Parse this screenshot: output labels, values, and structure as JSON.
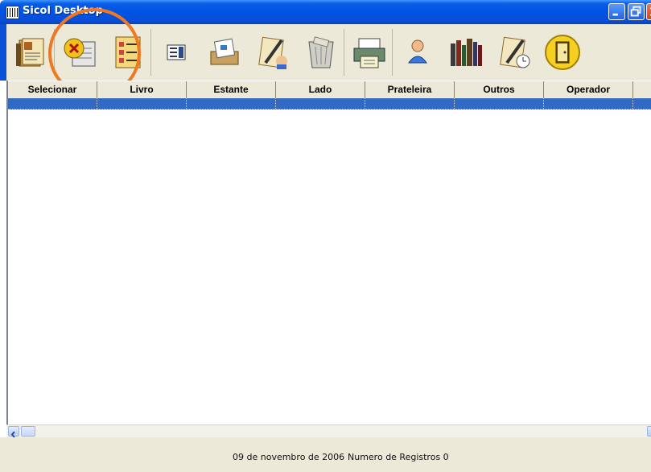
{
  "window": {
    "title": "Sicol Desktop",
    "icon": "barcode-icon",
    "controls": [
      "minimize-icon",
      "maximize-icon",
      "close-icon"
    ]
  },
  "toolbar": {
    "buttons": [
      {
        "icon": "open-book-icon"
      },
      {
        "icon": "cancel-icon"
      },
      {
        "icon": "list-document-icon"
      },
      {
        "icon": "form-selector-icon"
      },
      {
        "icon": "library-card-icon"
      },
      {
        "icon": "user-edit-icon"
      },
      {
        "icon": "trash-bin-icon"
      },
      {
        "icon": "printer-icon"
      },
      {
        "icon": "operator-icon"
      },
      {
        "icon": "bookshelf-icon"
      },
      {
        "icon": "edit-clock-icon"
      },
      {
        "icon": "exit-door-icon"
      }
    ]
  },
  "grid": {
    "columns": [
      "Selecionar",
      "Livro",
      "Estante",
      "Lado",
      "Prateleira",
      "Outros",
      "Operador"
    ],
    "selected_row": [
      "",
      "",
      "",
      "",
      "",
      "",
      ""
    ]
  },
  "status": {
    "date": "09 de novembro de 2006",
    "records_label": "Numero de Registros 0"
  },
  "colors": {
    "titlebar": "#0054e3",
    "selection": "#316ac5",
    "annotation": "#f07820",
    "chrome": "#ece9d8"
  }
}
